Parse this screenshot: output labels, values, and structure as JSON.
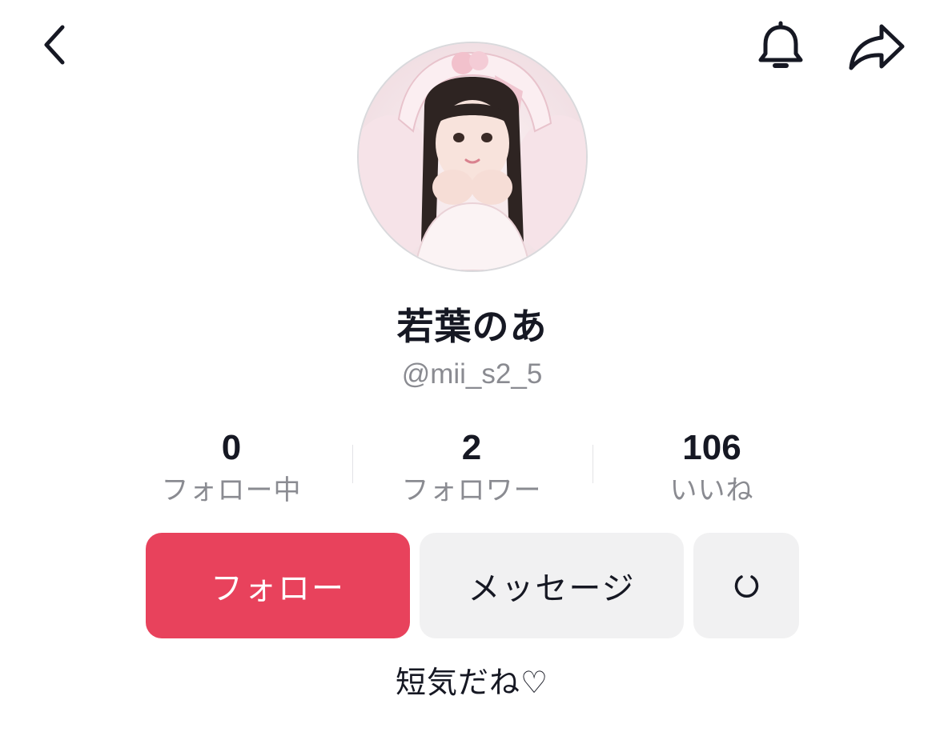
{
  "header": {
    "back_icon": "chevron-left-icon",
    "notification_icon": "bell-icon",
    "share_icon": "share-arrow-icon"
  },
  "profile": {
    "display_name": "若葉のあ",
    "username": "@mii_s2_5",
    "bio": "短気だね♡"
  },
  "stats": {
    "following": {
      "value": "0",
      "label": "フォロー中"
    },
    "followers": {
      "value": "2",
      "label": "フォロワー"
    },
    "likes": {
      "value": "106",
      "label": "いいね"
    }
  },
  "actions": {
    "follow_label": "フォロー",
    "message_label": "メッセージ",
    "more_icon": "refresh-icon"
  },
  "colors": {
    "follow_button": "#e8425c",
    "secondary_button": "#f1f1f2",
    "primary_text": "#161823",
    "muted_text": "#8a8b91"
  }
}
